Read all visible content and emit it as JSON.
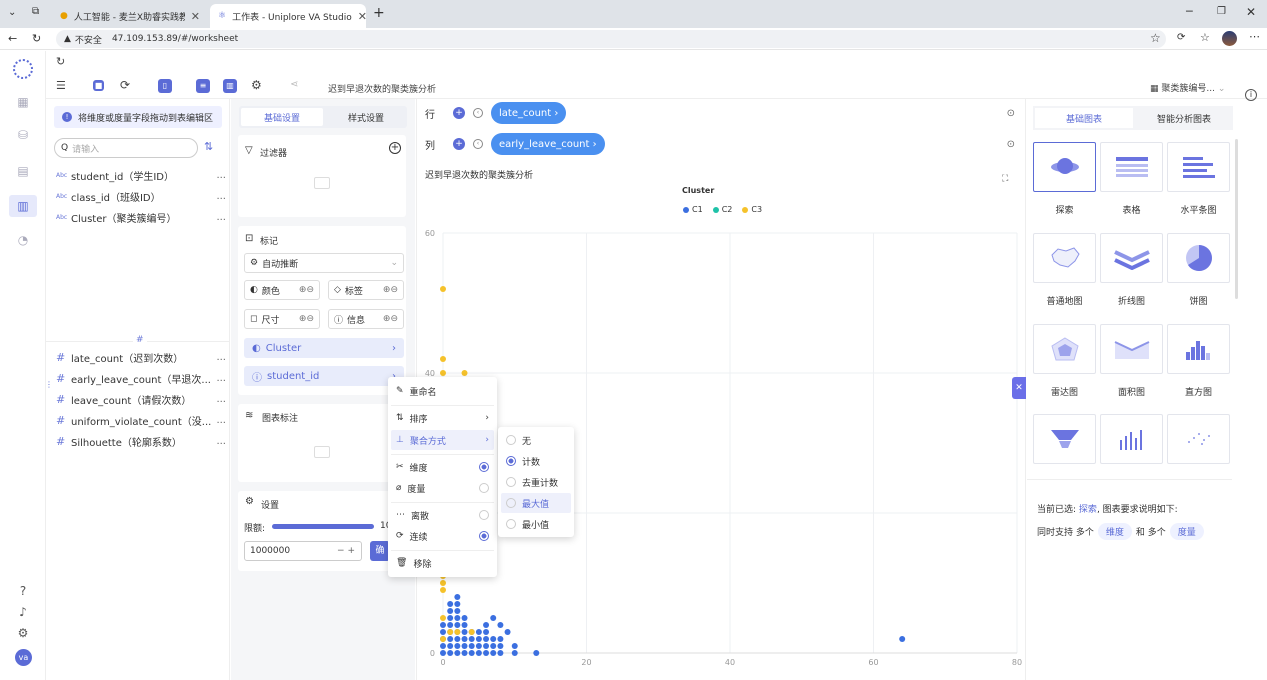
{
  "browser": {
    "tabs": [
      {
        "label": "人工智能 - 麦兰X助睿实践教学平台"
      },
      {
        "label": "工作表 - Uniplore VA Studio"
      }
    ],
    "insecure_label": "不安全",
    "url": "47.109.153.89/#/worksheet"
  },
  "toolbar": {
    "title": "迟到早退次数的聚类簇分析",
    "chart_type_label": "聚类簇编号..."
  },
  "field_panel": {
    "hint": "将维度或度量字段拖动到表编辑区",
    "search_placeholder": "请输入",
    "type_abc": "Abc",
    "type_hash": "#",
    "dimensions": [
      {
        "label": "student_id（学生ID）"
      },
      {
        "label": "class_id（班级ID）"
      },
      {
        "label": "Cluster（聚类簇编号）"
      }
    ],
    "measures": [
      {
        "label": "late_count（迟到次数）"
      },
      {
        "label": "early_leave_count（早退次..."
      },
      {
        "label": "leave_count（请假次数）"
      },
      {
        "label": "uniform_violate_count（没..."
      },
      {
        "label": "Silhouette（轮廓系数）"
      }
    ],
    "more": "..."
  },
  "settings": {
    "tab_basic": "基础设置",
    "tab_style": "样式设置",
    "filter_label": "过滤器",
    "marks_label": "标记",
    "auto_infer": "自动推断",
    "color": "颜色",
    "label": "标签",
    "size": "尺寸",
    "info": "信息",
    "cluster_pill": "Cluster",
    "student_pill": "student_id",
    "annotation_label": "图表标注",
    "settings_label": "设置",
    "limit_label": "限额:",
    "limit_value": "1000000",
    "limit_short": "10",
    "confirm": "确"
  },
  "shelves": {
    "row_label": "行",
    "col_label": "列",
    "row_field": "late_count ›",
    "col_field": "early_leave_count ›"
  },
  "chart_data": {
    "type": "scatter",
    "title": "迟到早退次数的聚类簇分析",
    "legend_title": "Cluster",
    "legend_placement": "top-center",
    "xlim": [
      0,
      80
    ],
    "ylim": [
      0,
      60
    ],
    "x_ticks": [
      "0",
      "20",
      "40",
      "60",
      "80"
    ],
    "y_ticks": [
      "0",
      "20",
      "40",
      "60"
    ],
    "series": [
      {
        "name": "C1",
        "color": "#3b6fe0",
        "points": [
          [
            0,
            0
          ],
          [
            1,
            0
          ],
          [
            2,
            0
          ],
          [
            3,
            0
          ],
          [
            4,
            0
          ],
          [
            5,
            0
          ],
          [
            6,
            0
          ],
          [
            7,
            0
          ],
          [
            8,
            0
          ],
          [
            10,
            0
          ],
          [
            13,
            0
          ],
          [
            0,
            1
          ],
          [
            1,
            1
          ],
          [
            2,
            1
          ],
          [
            3,
            1
          ],
          [
            4,
            1
          ],
          [
            5,
            1
          ],
          [
            6,
            1
          ],
          [
            7,
            1
          ],
          [
            8,
            1
          ],
          [
            10,
            1
          ],
          [
            0,
            2
          ],
          [
            1,
            2
          ],
          [
            2,
            2
          ],
          [
            3,
            2
          ],
          [
            4,
            2
          ],
          [
            5,
            2
          ],
          [
            6,
            2
          ],
          [
            7,
            2
          ],
          [
            8,
            2
          ],
          [
            0,
            3
          ],
          [
            1,
            3
          ],
          [
            2,
            3
          ],
          [
            3,
            3
          ],
          [
            4,
            3
          ],
          [
            5,
            3
          ],
          [
            6,
            3
          ],
          [
            9,
            3
          ],
          [
            0,
            4
          ],
          [
            1,
            4
          ],
          [
            2,
            4
          ],
          [
            3,
            4
          ],
          [
            6,
            4
          ],
          [
            8,
            4
          ],
          [
            1,
            5
          ],
          [
            2,
            5
          ],
          [
            3,
            5
          ],
          [
            7,
            5
          ],
          [
            1,
            6
          ],
          [
            2,
            6
          ],
          [
            1,
            7
          ],
          [
            2,
            7
          ],
          [
            2,
            8
          ],
          [
            64,
            2
          ]
        ]
      },
      {
        "name": "C2",
        "color": "#1fc2a8",
        "points": []
      },
      {
        "name": "C3",
        "color": "#f5c22b",
        "points": [
          [
            0,
            2
          ],
          [
            1,
            3
          ],
          [
            2,
            3
          ],
          [
            0,
            5
          ],
          [
            4,
            3
          ],
          [
            0,
            9
          ],
          [
            0,
            10
          ],
          [
            0,
            11
          ],
          [
            0,
            12
          ],
          [
            1,
            13
          ],
          [
            0,
            14
          ],
          [
            1,
            16
          ],
          [
            0,
            18
          ],
          [
            1,
            20
          ],
          [
            0,
            22
          ],
          [
            0,
            25
          ],
          [
            0,
            28
          ],
          [
            0,
            32
          ],
          [
            0,
            38
          ],
          [
            0,
            40
          ],
          [
            3,
            40
          ],
          [
            0,
            42
          ],
          [
            0,
            52
          ]
        ]
      }
    ]
  },
  "right_panel": {
    "tab_basic": "基础图表",
    "tab_smart": "智能分析图表",
    "charts": [
      {
        "label": "探索"
      },
      {
        "label": "表格"
      },
      {
        "label": "水平条图"
      },
      {
        "label": "普通地图"
      },
      {
        "label": "折线图"
      },
      {
        "label": "饼图"
      },
      {
        "label": "雷达图"
      },
      {
        "label": "面积图"
      },
      {
        "label": "直方图"
      }
    ],
    "selected_prefix": "当前已选:",
    "selected_chart": "探索",
    "selected_suffix": ", 图表要求说明如下:",
    "req_a": "同时支持 多个",
    "req_dim": "维度",
    "req_b": "和 多个",
    "req_measure": "度量"
  },
  "context_menu": {
    "rename": "重命名",
    "sort": "排序",
    "aggregate": "聚合方式",
    "dimension": "维度",
    "measure": "度量",
    "discrete": "离散",
    "continuous": "连续",
    "remove": "移除"
  },
  "agg_menu": {
    "none": "无",
    "count": "计数",
    "distinct": "去重计数",
    "max": "最大值",
    "min": "最小值"
  },
  "nav_avatar": "va"
}
